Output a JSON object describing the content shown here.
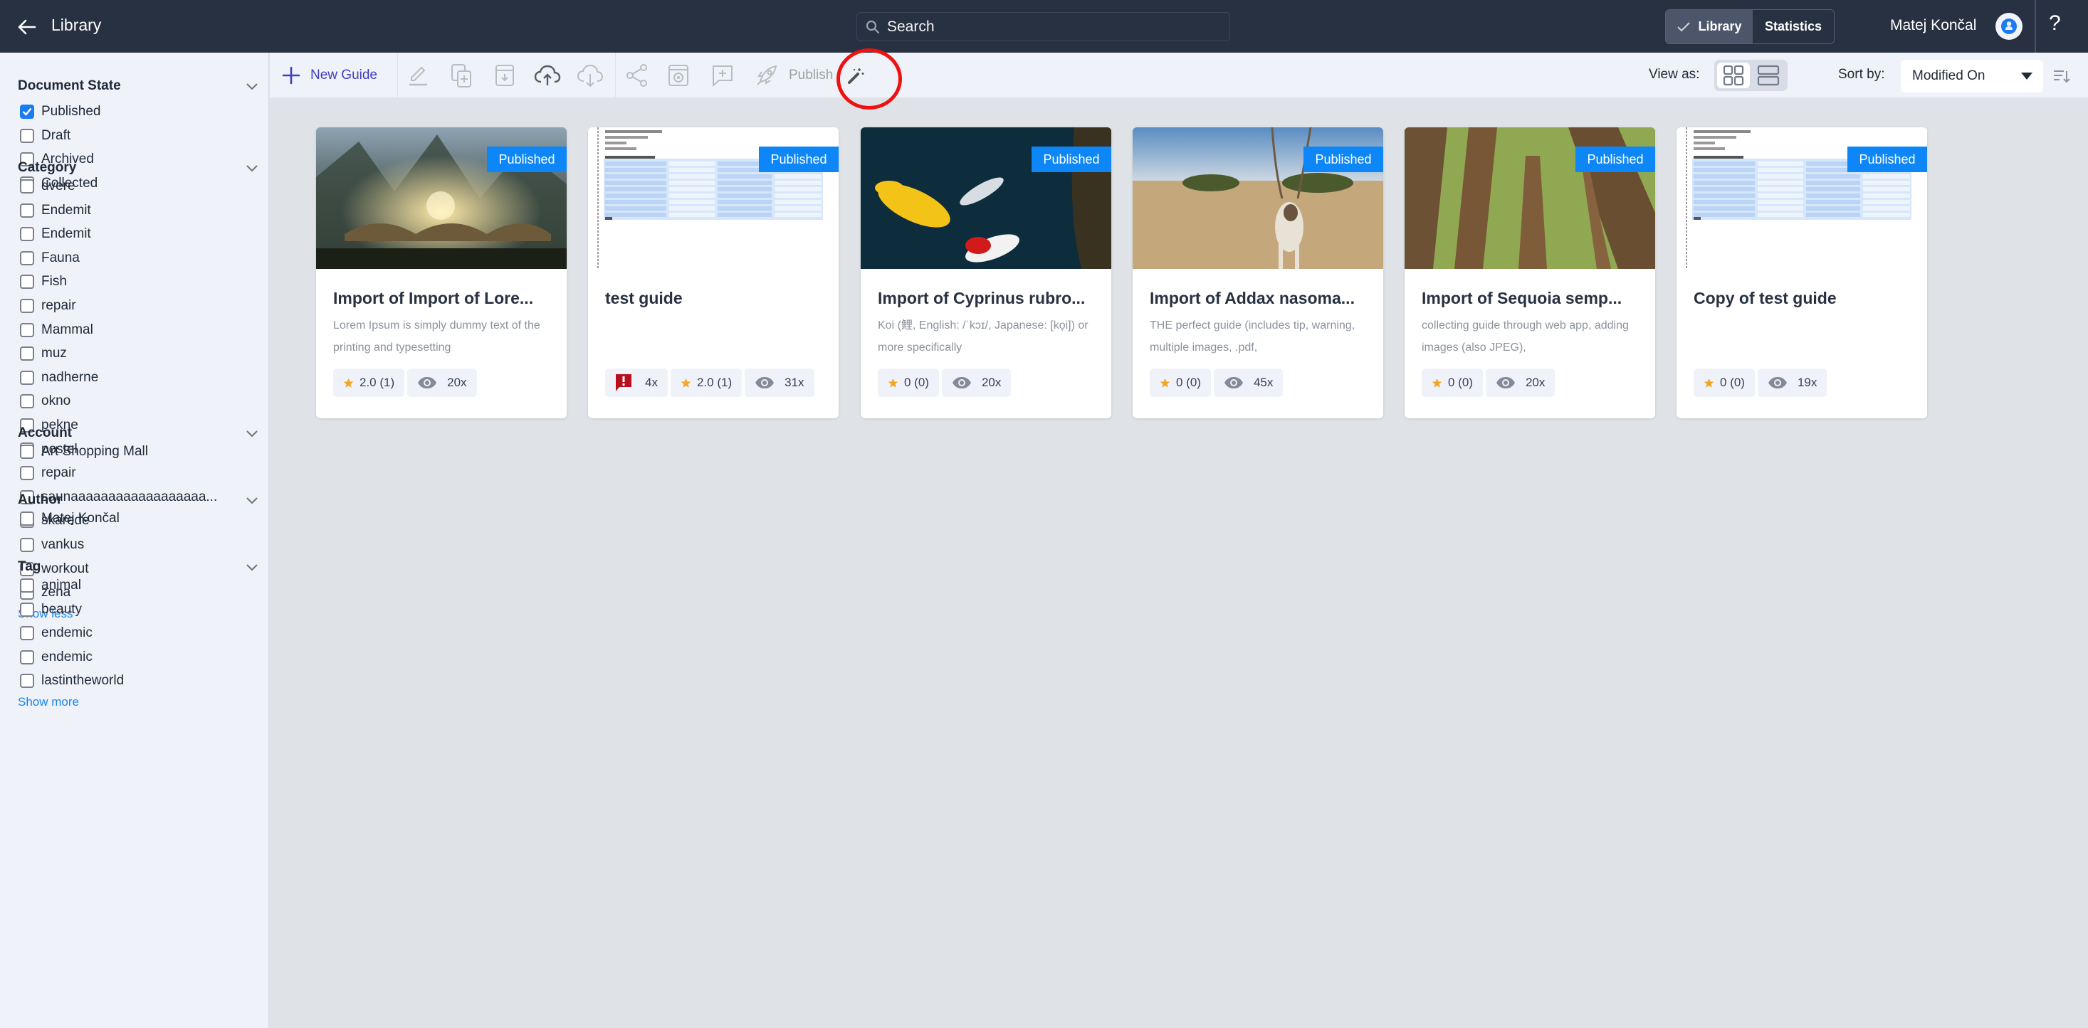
{
  "header": {
    "back_icon": "arrow-left-icon",
    "title": "Library",
    "search": {
      "placeholder": "Search",
      "value": ""
    },
    "view_switch": [
      {
        "label": "Library",
        "active": true,
        "icon": "check-icon"
      },
      {
        "label": "Statistics",
        "active": false
      }
    ],
    "user_name": "Matej Končal",
    "help_label": "?"
  },
  "toolbar": {
    "new_guide_label": "New Guide",
    "publish_label": "Publish",
    "icons": [
      "plus-icon",
      "edit-icon",
      "duplicate-icon",
      "archive-icon",
      "cloud-upload-icon",
      "cloud-download-icon",
      "share-icon",
      "preview-icon",
      "add-comment-icon",
      "rocket-icon",
      "magic-wand-icon"
    ],
    "view_as_label": "View as:",
    "view_mode": "grid",
    "sort_label": "Sort by:",
    "sort_value": "Modified On"
  },
  "sidebar": {
    "sections": [
      {
        "title": "Document State",
        "items": [
          {
            "label": "Published",
            "checked": true
          },
          {
            "label": "Draft",
            "checked": false
          },
          {
            "label": "Archived",
            "checked": false
          },
          {
            "label": "Collected",
            "checked": false
          }
        ]
      },
      {
        "title": "Category",
        "items": [
          {
            "label": "dvere",
            "checked": false
          },
          {
            "label": "Endemit",
            "checked": false
          },
          {
            "label": "Endemit",
            "checked": false
          },
          {
            "label": "Fauna",
            "checked": false
          },
          {
            "label": "Fish",
            "checked": false
          },
          {
            "label": "repair",
            "checked": false
          },
          {
            "label": "Mammal",
            "checked": false
          },
          {
            "label": "muz",
            "checked": false
          },
          {
            "label": "nadherne",
            "checked": false
          },
          {
            "label": "okno",
            "checked": false
          },
          {
            "label": "pekne",
            "checked": false
          },
          {
            "label": "postel",
            "checked": false
          },
          {
            "label": "repair",
            "checked": false
          },
          {
            "label": "saunaaaaaaaaaaaaaaaaaa...",
            "checked": false
          },
          {
            "label": "skarede",
            "checked": false
          },
          {
            "label": "vankus",
            "checked": false
          },
          {
            "label": "workout",
            "checked": false
          },
          {
            "label": "zena",
            "checked": false
          }
        ],
        "toggle_label": "Show less"
      },
      {
        "title": "Account",
        "items": [
          {
            "label": "Art Shopping Mall",
            "checked": false
          }
        ]
      },
      {
        "title": "Author",
        "items": [
          {
            "label": "Matej Končal",
            "checked": false
          }
        ]
      },
      {
        "title": "Tag",
        "items": [
          {
            "label": "animal",
            "checked": false
          },
          {
            "label": "beauty",
            "checked": false
          },
          {
            "label": "endemic",
            "checked": false
          },
          {
            "label": "endemic",
            "checked": false
          },
          {
            "label": "lastintheworld",
            "checked": false
          }
        ],
        "toggle_label": "Show more"
      }
    ]
  },
  "cards": [
    {
      "title": "Import of Import of Lore...",
      "description": "Lorem Ipsum is simply dummy text of the printing and typesetting",
      "status": "Published",
      "thumb": "fantasy-valley",
      "comments": null,
      "rating": "2.0 (1)",
      "views": "20x"
    },
    {
      "title": "test guide",
      "description": "",
      "status": "Published",
      "thumb": "document",
      "comments": "4x",
      "rating": "2.0 (1)",
      "views": "31x"
    },
    {
      "title": "Import of Cyprinus rubro...",
      "description": "Koi (鯉, English: /ˈkɔɪ/, Japanese: [ko̞i]) or more specifically",
      "status": "Published",
      "thumb": "koi",
      "comments": null,
      "rating": "0 (0)",
      "views": "20x"
    },
    {
      "title": "Import of Addax nasoma...",
      "description": "THE perfect guide (includes tip, warning, multiple images, .pdf,",
      "status": "Published",
      "thumb": "addax",
      "comments": null,
      "rating": "0 (0)",
      "views": "45x"
    },
    {
      "title": "Import of Sequoia semp...",
      "description": "collecting guide through web app, adding images (also JPEG),",
      "status": "Published",
      "thumb": "sequoia",
      "comments": null,
      "rating": "0 (0)",
      "views": "20x"
    },
    {
      "title": "Copy of test guide",
      "description": "",
      "status": "Published",
      "thumb": "document",
      "comments": null,
      "rating": "0 (0)",
      "views": "19x"
    }
  ],
  "colors": {
    "header_bg": "#283142",
    "accent": "#1a7bf2",
    "badge": "#0d86f7",
    "link": "#1a84f0",
    "new_guide": "#3f3fbf",
    "comment_badge": "#b80f1e",
    "star": "#f5a623",
    "annotation": "#ee1111"
  }
}
